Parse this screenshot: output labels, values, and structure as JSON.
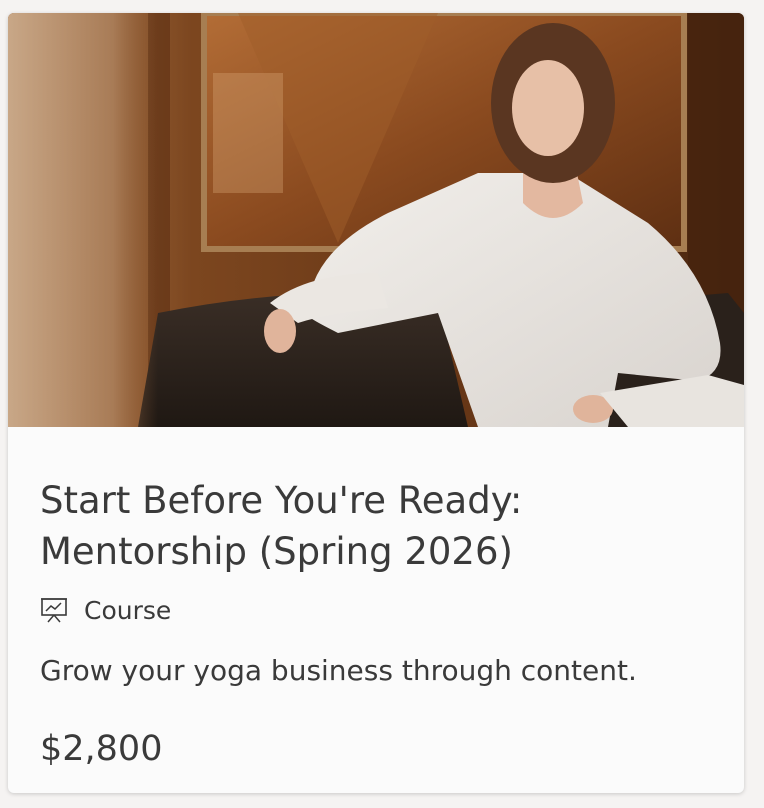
{
  "product": {
    "title_line1": "Start Before You're Ready:",
    "title_line2": "Mentorship (Spring 2026)",
    "type_label": "Course",
    "type_icon": "presentation-icon",
    "description": "Grow your yoga business through content.",
    "price": "$2,800"
  },
  "colors": {
    "text": "#3a3a3a",
    "card_bg": "#fbfbfb",
    "page_bg": "#f5f3f2"
  }
}
